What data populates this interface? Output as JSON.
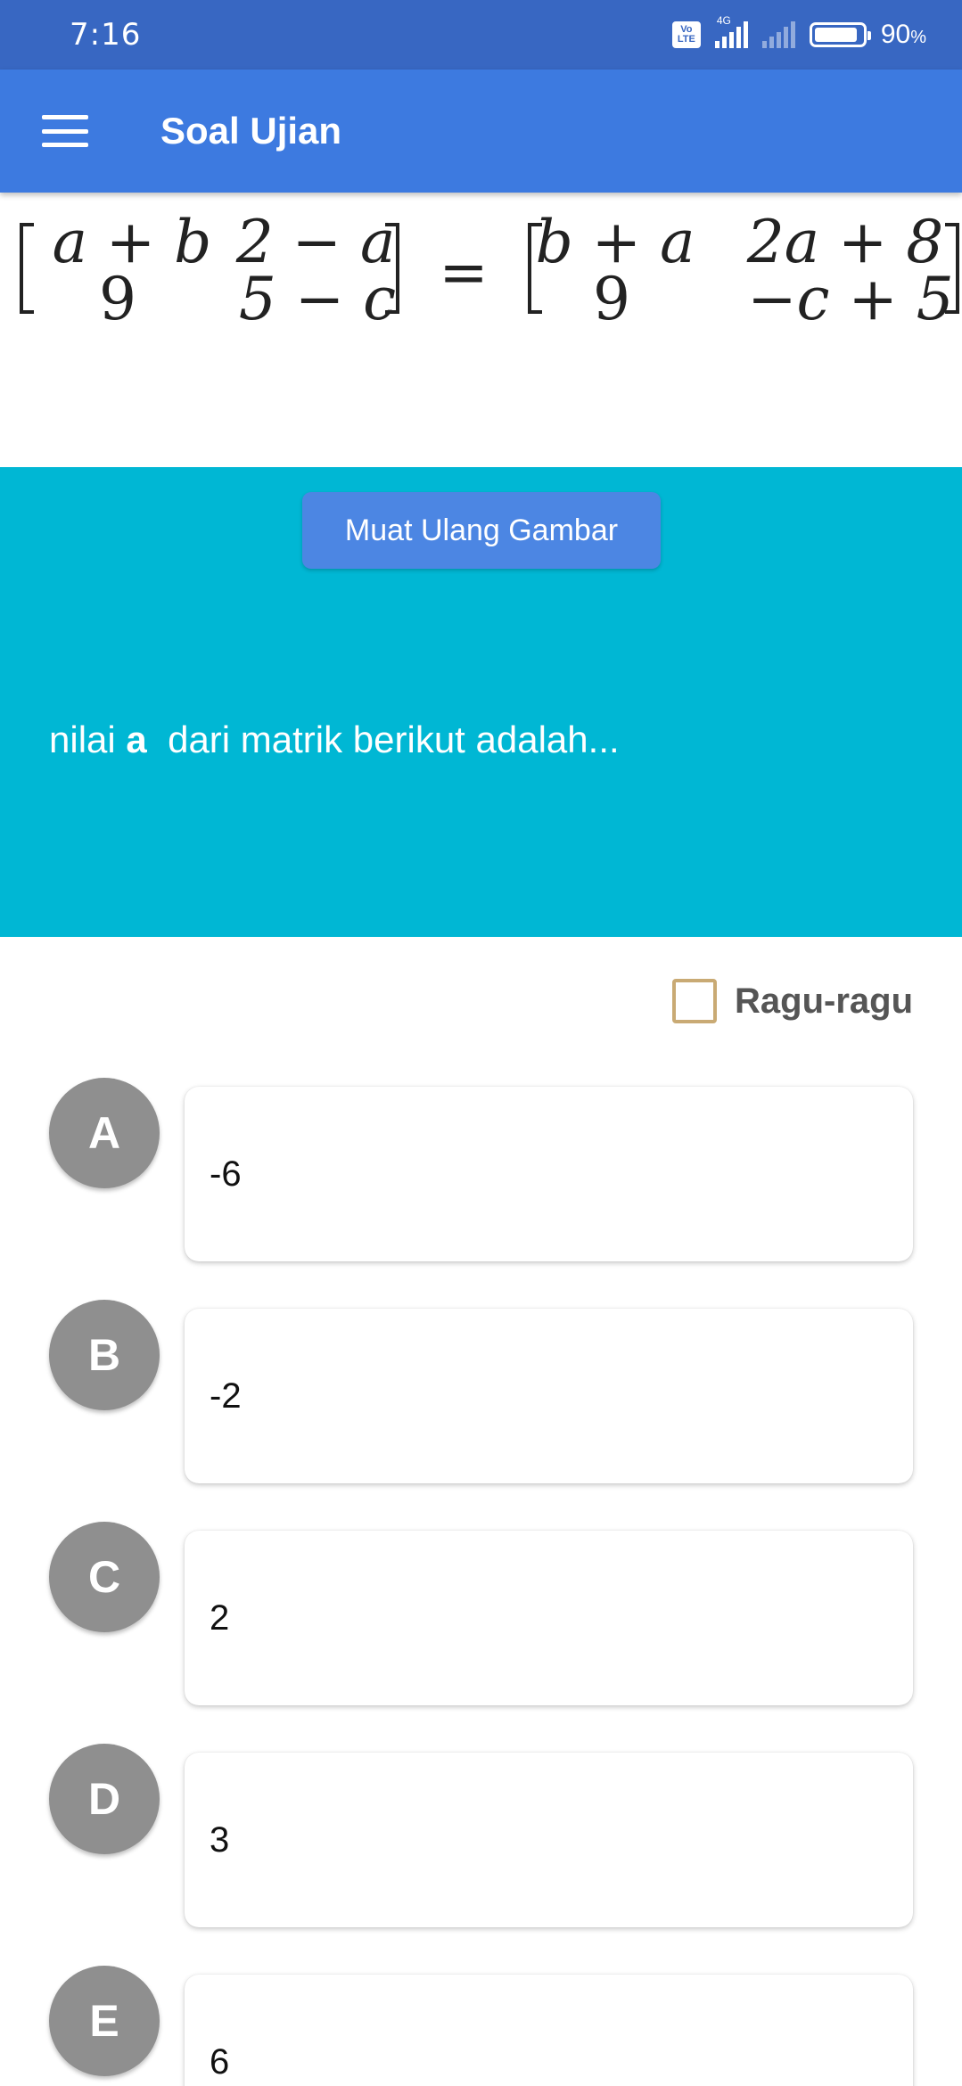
{
  "status_bar": {
    "time": "7:16",
    "volte_top": "Vo",
    "volte_bottom": "LTE",
    "network": "4G",
    "battery": "90",
    "battery_unit": "%"
  },
  "app_bar": {
    "title": "Soal Ujian",
    "menu_icon": "hamburger-menu-icon"
  },
  "question": {
    "matrix": {
      "left": [
        [
          "a + b",
          "2 − a"
        ],
        [
          "9",
          "5 − c"
        ]
      ],
      "equals": "=",
      "right": [
        [
          "b + a",
          "2a + 8"
        ],
        [
          "9",
          "−c + 5"
        ]
      ]
    },
    "reload_button": "Muat Ulang Gambar",
    "text_prefix": "nilai ",
    "text_var": "a",
    "text_suffix": "  dari matrik berikut adalah..."
  },
  "doubt": {
    "label": "Ragu-ragu",
    "checked": false
  },
  "options": [
    {
      "letter": "A",
      "value": "-6"
    },
    {
      "letter": "B",
      "value": "-2"
    },
    {
      "letter": "C",
      "value": "2"
    },
    {
      "letter": "D",
      "value": "3"
    },
    {
      "letter": "E",
      "value": "6"
    }
  ],
  "colors": {
    "status_bar": "#3867c2",
    "app_bar": "#3d7ae0",
    "question_panel": "#00b7d4",
    "reload_button": "#4c86e3",
    "option_letter": "#8f8f8f",
    "checkbox_border": "#c9aa74"
  }
}
